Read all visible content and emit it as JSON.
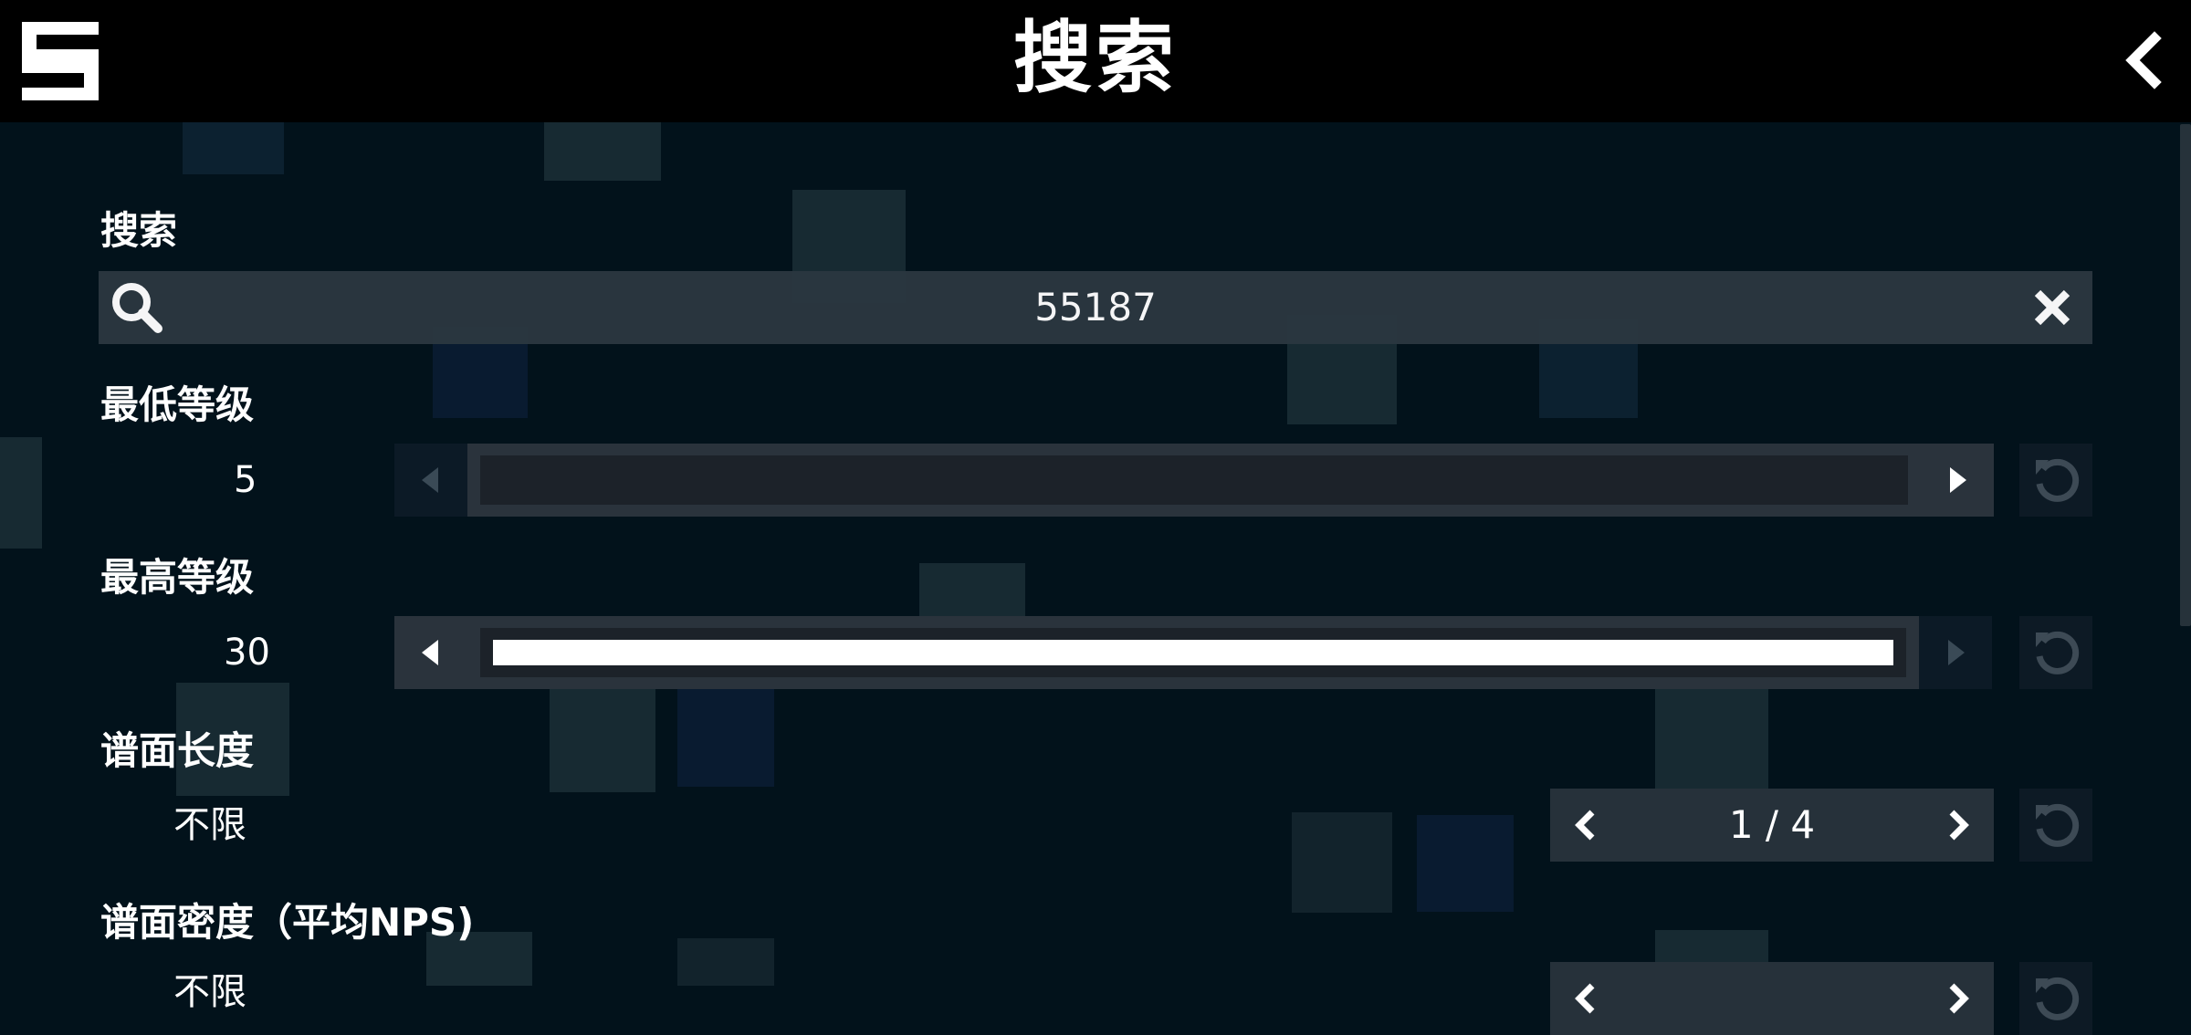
{
  "header": {
    "title": "搜索",
    "logo_icon": "s-logo-icon",
    "back_icon": "chevron-left-icon"
  },
  "search": {
    "label": "搜索",
    "value": "55187",
    "search_icon": "search-icon",
    "clear_icon": "close-icon"
  },
  "min_level": {
    "label": "最低等级",
    "value": "5",
    "fill_fraction": 0.0
  },
  "max_level": {
    "label": "最高等级",
    "value": "30",
    "fill_fraction": 1.0
  },
  "chart_length": {
    "label": "谱面长度",
    "value": "不限",
    "page": "1 / 4"
  },
  "chart_density": {
    "label": "谱面密度（平均NPS)",
    "value": "不限"
  },
  "colors": {
    "background": "#02121b",
    "header": "#000000",
    "field": "#2b3740",
    "fill": "#ffffff"
  }
}
